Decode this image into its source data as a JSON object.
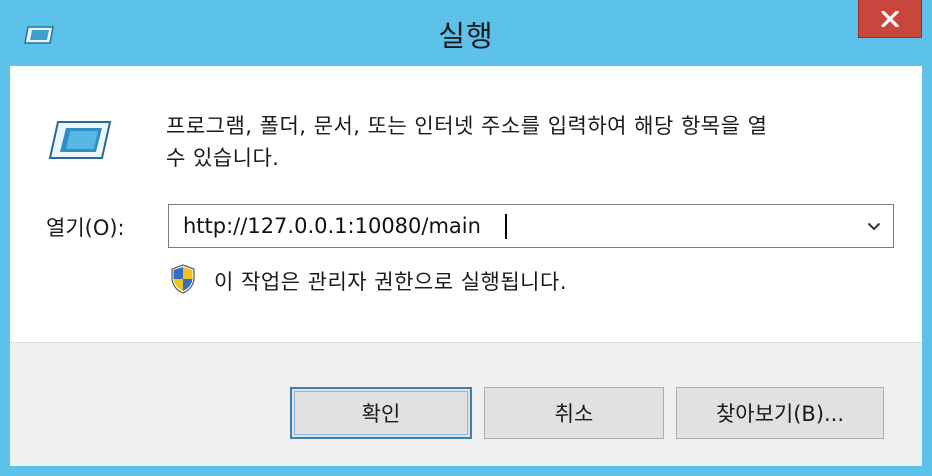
{
  "window": {
    "title": "실행",
    "close_label": "x"
  },
  "description": {
    "line1": "프로그램, 폴더, 문서, 또는 인터넷 주소를 입력하여 해당 항목을 열",
    "line2": "수 있습니다."
  },
  "open_field": {
    "label": "열기(O):",
    "value": "http://127.0.0.1:10080/main"
  },
  "admin_note": "이 작업은 관리자 권한으로 실행됩니다.",
  "buttons": {
    "ok": "확인",
    "cancel": "취소",
    "browse": "찾아보기(B)..."
  },
  "colors": {
    "titlebar": "#5cc2ea",
    "close_button": "#c9463d",
    "default_button_border": "#3c7fb1"
  },
  "icons": {
    "title": "run-app-icon",
    "main": "run-app-icon",
    "admin": "uac-shield-icon",
    "dropdown": "chevron-down-icon",
    "close": "close-icon"
  }
}
